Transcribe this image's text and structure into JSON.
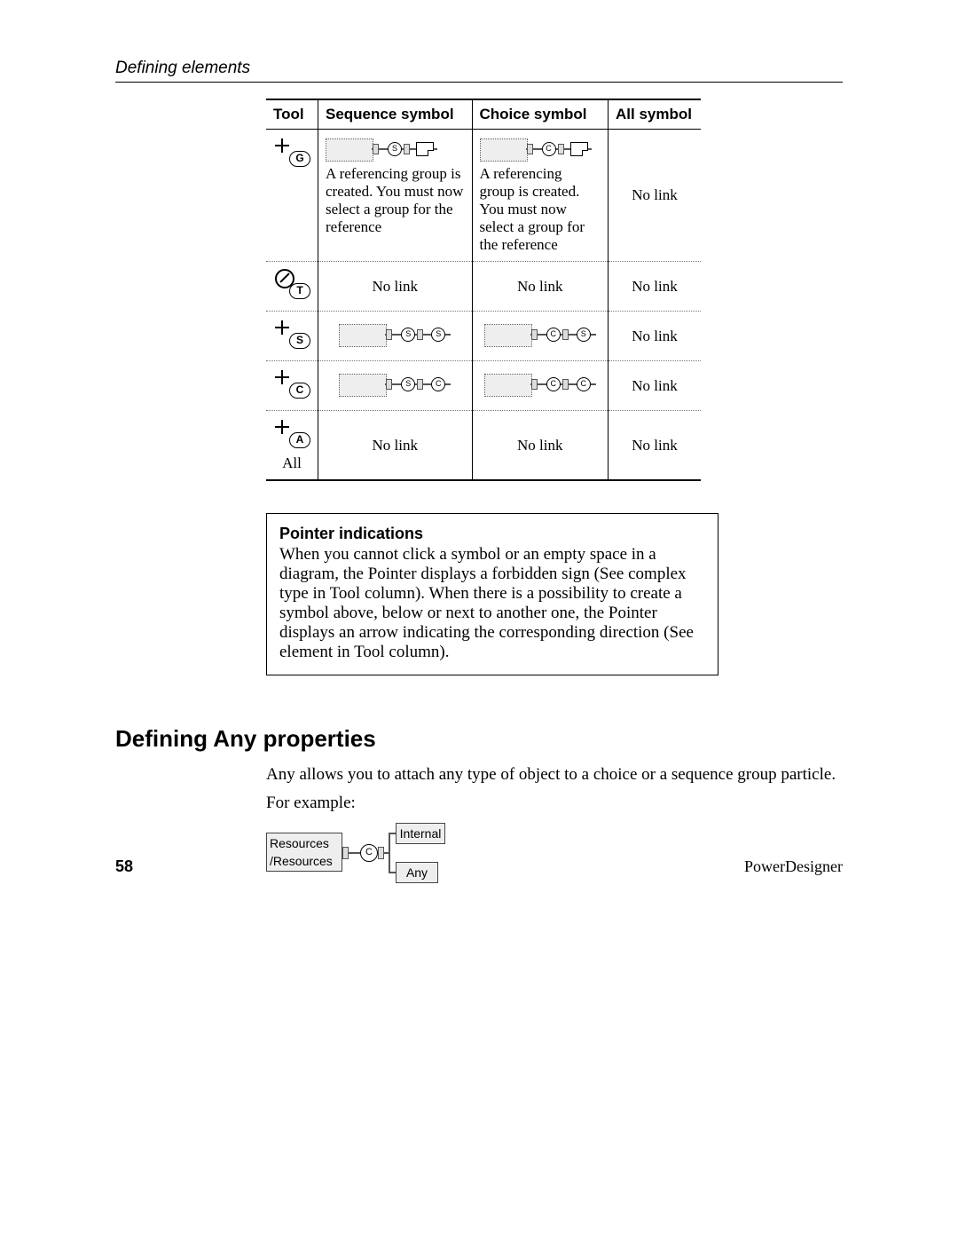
{
  "running_head": "Defining elements",
  "table": {
    "headers": {
      "tool": "Tool",
      "seq": "Sequence symbol",
      "choice": "Choice symbol",
      "all": "All symbol"
    },
    "rows": [
      {
        "tool": {
          "letter": "G",
          "forbidden": false,
          "label": ""
        },
        "seq": {
          "diagram": {
            "type": "ref",
            "center_letter": "S"
          },
          "text": "A referencing group is created. You must now select a group for the reference"
        },
        "choice": {
          "diagram": {
            "type": "ref",
            "center_letter": "C"
          },
          "text": "A referencing group is created. You must now select a group for the reference"
        },
        "all": {
          "text": "No link"
        }
      },
      {
        "tool": {
          "letter": "T",
          "forbidden": true,
          "label": ""
        },
        "seq": {
          "text": "No link"
        },
        "choice": {
          "text": "No link"
        },
        "all": {
          "text": "No link"
        }
      },
      {
        "tool": {
          "letter": "S",
          "forbidden": false,
          "label": ""
        },
        "seq": {
          "diagram": {
            "type": "chain",
            "center_letter": "S",
            "end_letter": "S"
          }
        },
        "choice": {
          "diagram": {
            "type": "chain",
            "center_letter": "C",
            "end_letter": "S"
          }
        },
        "all": {
          "text": "No link"
        }
      },
      {
        "tool": {
          "letter": "C",
          "forbidden": false,
          "label": ""
        },
        "seq": {
          "diagram": {
            "type": "chain",
            "center_letter": "S",
            "end_letter": "C"
          }
        },
        "choice": {
          "diagram": {
            "type": "chain",
            "center_letter": "C",
            "end_letter": "C"
          }
        },
        "all": {
          "text": "No link"
        }
      },
      {
        "tool": {
          "letter": "A",
          "forbidden": false,
          "label": "All"
        },
        "seq": {
          "text": "No link"
        },
        "choice": {
          "text": "No link"
        },
        "all": {
          "text": "No link"
        }
      }
    ]
  },
  "note": {
    "title": "Pointer indications",
    "body": "When you cannot click a symbol or an empty space in a diagram, the Pointer displays a forbidden sign (See complex type in Tool column). When there is a possibility to create a symbol above, below or next to another one, the Pointer displays an arrow indicating the corresponding direction (See element in Tool column)."
  },
  "section": {
    "heading": "Defining Any properties",
    "p1": "Any allows you to attach any type of object to a choice or a sequence group particle.",
    "p2": "For example:"
  },
  "example_diagram": {
    "root_open": "Resources",
    "root_close": "/Resources",
    "center_letter": "C",
    "node_top": "Internal",
    "node_bottom": "Any"
  },
  "footer": {
    "page": "58",
    "product": "PowerDesigner"
  }
}
